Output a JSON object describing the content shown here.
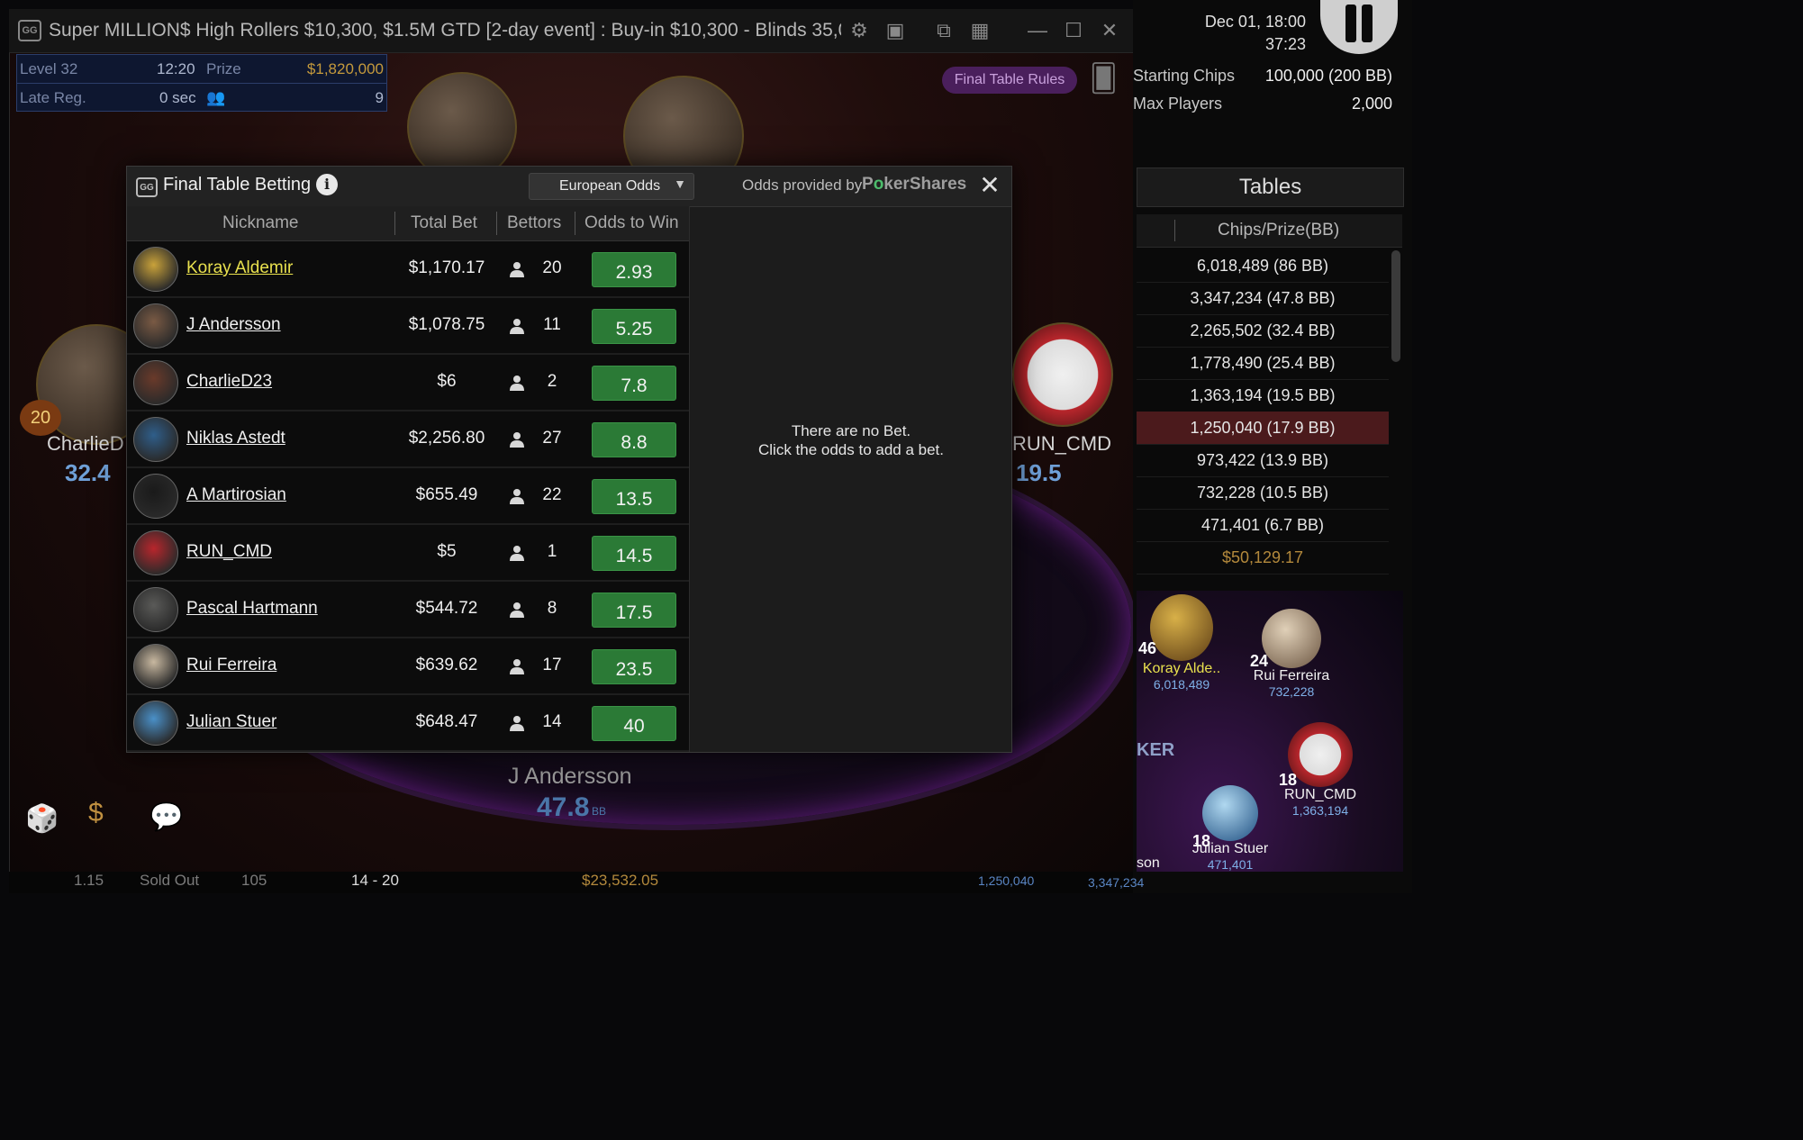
{
  "client": {
    "title": "Super MILLION$ High Rollers $10,300, $1.5M GTD [2-day event] : Buy-in $10,300 - Blinds 35,00..",
    "level_label": "Level 32",
    "level_time": "12:20",
    "prize_label": "Prize",
    "prize_value": "$1,820,000",
    "late_reg_label": "Late Reg.",
    "late_reg_value": "0 sec",
    "players_value": "9",
    "final_table_rules": "Final Table Rules",
    "seats": [
      {
        "name": "CharlieD",
        "stack": "32.4",
        "unit": "BB",
        "level": "20"
      },
      {
        "name": "RUN_CMD",
        "stack": "19.5",
        "unit": "BB"
      },
      {
        "name": "J Andersson",
        "stack": "47.8",
        "unit": "BB"
      }
    ],
    "bottom_strip": [
      "1.15",
      "Sold Out",
      "105",
      "14 - 20",
      "$23,532.05"
    ]
  },
  "right_panel": {
    "date": "Dec 01, 18:00",
    "time": "37:23",
    "starting_chips_label": "Starting Chips",
    "starting_chips_value": "100,000 (200 BB)",
    "max_players_label": "Max Players",
    "max_players_value": "2,000",
    "tables_title": "Tables",
    "chips_col": "Chips/Prize(BB)",
    "chip_rows": [
      "6,018,489 (86 BB)",
      "3,347,234 (47.8 BB)",
      "2,265,502 (32.4 BB)",
      "1,778,490 (25.4 BB)",
      "1,363,194 (19.5 BB)",
      "1,250,040 (17.9 BB)",
      "973,422 (13.9 BB)",
      "732,228 (10.5 BB)",
      "471,401 (6.7 BB)",
      "$50,129.17"
    ],
    "mini_table": {
      "players": [
        {
          "name": "Koray Alde..",
          "chips": "6,018,489",
          "level": "46"
        },
        {
          "name": "Rui Ferreira",
          "chips": "732,228",
          "level": "24"
        },
        {
          "name": "RUN_CMD",
          "chips": "1,363,194",
          "level": "18"
        },
        {
          "name": "Julian Stuer",
          "chips": "471,401",
          "level": "18"
        },
        {
          "name": "son",
          "chips": ""
        }
      ],
      "bottom_chips": [
        "1,250,040",
        "3,347,234"
      ]
    }
  },
  "modal": {
    "title": "Final Table Betting",
    "odds_format": "European Odds",
    "provided_by": "Odds provided by",
    "provider_a": "P",
    "provider_o": "o",
    "provider_b": "kerShares",
    "headers": {
      "nickname": "Nickname",
      "total_bet": "Total Bet",
      "bettors": "Bettors",
      "odds": "Odds to Win"
    },
    "players": [
      {
        "nickname": "Koray Aldemir",
        "total_bet": "$1,170.17",
        "bettors": "20",
        "odds": "2.93",
        "avatar_color": "#c9a23a"
      },
      {
        "nickname": "J Andersson",
        "total_bet": "$1,078.75",
        "bettors": "11",
        "odds": "5.25",
        "avatar_color": "#7a5a44"
      },
      {
        "nickname": "CharlieD23",
        "total_bet": "$6",
        "bettors": "2",
        "odds": "7.8",
        "avatar_color": "#6a3a2a"
      },
      {
        "nickname": "Niklas Astedt",
        "total_bet": "$2,256.80",
        "bettors": "27",
        "odds": "8.8",
        "avatar_color": "#2f5e8a"
      },
      {
        "nickname": "A Martirosian",
        "total_bet": "$655.49",
        "bettors": "22",
        "odds": "13.5",
        "avatar_color": "#1a1a1a"
      },
      {
        "nickname": "RUN_CMD",
        "total_bet": "$5",
        "bettors": "1",
        "odds": "14.5",
        "avatar_color": "#b8262c"
      },
      {
        "nickname": "Pascal Hartmann",
        "total_bet": "$544.72",
        "bettors": "8",
        "odds": "17.5",
        "avatar_color": "#5a5a58"
      },
      {
        "nickname": "Rui Ferreira",
        "total_bet": "$639.62",
        "bettors": "17",
        "odds": "23.5",
        "avatar_color": "#c8b8a0"
      },
      {
        "nickname": "Julian Stuer",
        "total_bet": "$648.47",
        "bettors": "14",
        "odds": "40",
        "avatar_color": "#4a90c8"
      }
    ],
    "no_bet_line1": "There are no Bet.",
    "no_bet_line2": "Click the odds to add a bet."
  },
  "colors": {
    "odds_button": "#2b7a36",
    "favorite_name": "#e9e14e",
    "prize_gold": "#c59a3c",
    "stack_blue": "#6fa0d8"
  }
}
